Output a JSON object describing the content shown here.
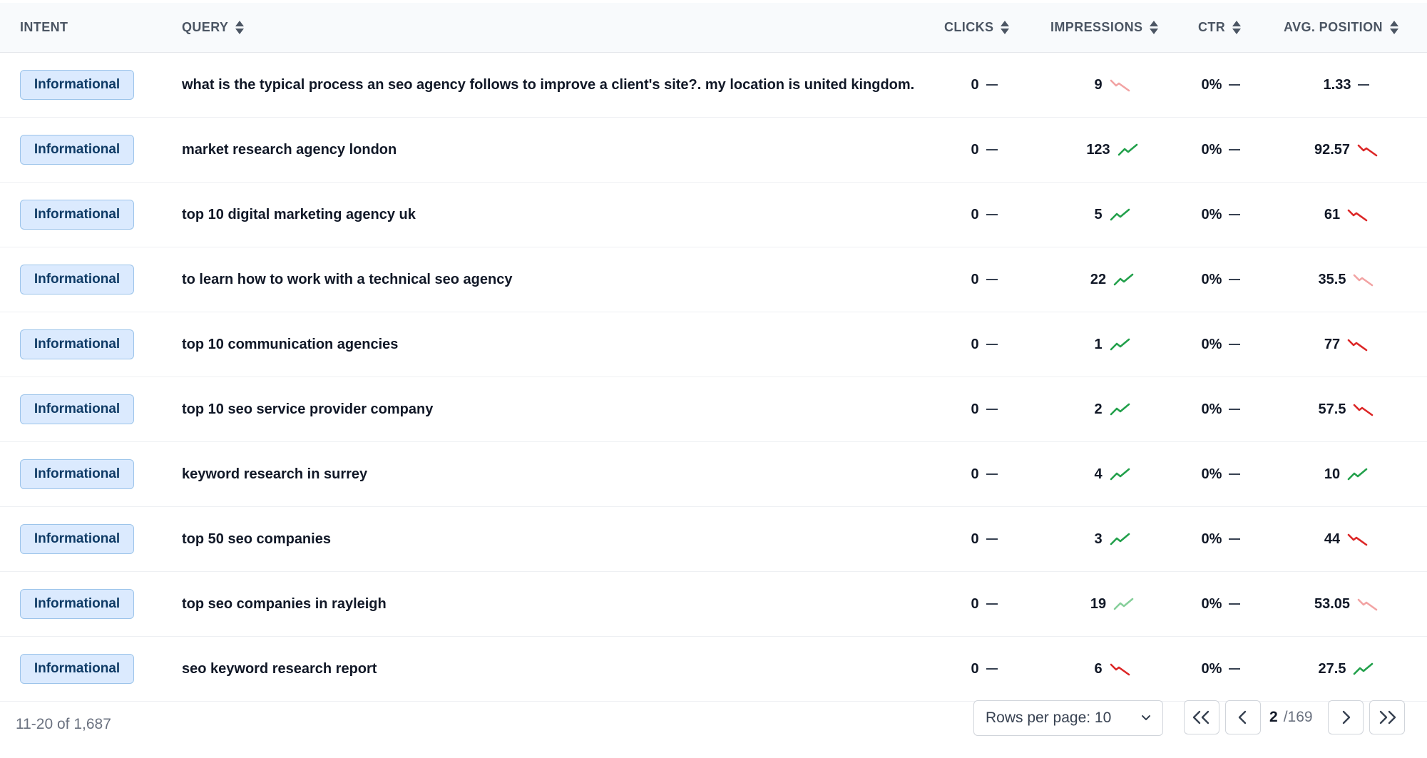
{
  "columns": {
    "intent": "INTENT",
    "query": "QUERY",
    "clicks": "CLICKS",
    "impressions": "IMPRESSIONS",
    "ctr": "CTR",
    "avg_position": "AVG. POSITION"
  },
  "colors": {
    "trend_up": "#22a04b",
    "trend_up_faint": "#86cf9a",
    "trend_down": "#dc2626",
    "trend_down_faint": "#f2a3a3",
    "badge_bg": "#dbeafe",
    "badge_border": "#9cc4ea"
  },
  "rows": [
    {
      "intent": "Informational",
      "query": "what is the typical process an seo agency follows to improve a client's site?. my location is united kingdom.",
      "clicks": "0",
      "impressions": "9",
      "impressions_trend": "down-faint-icon",
      "ctr": "0%",
      "avg_position": "1.33",
      "position_trend": "flat"
    },
    {
      "intent": "Informational",
      "query": "market research agency london",
      "clicks": "0",
      "impressions": "123",
      "impressions_trend": "up-icon",
      "ctr": "0%",
      "avg_position": "92.57",
      "position_trend": "down-icon"
    },
    {
      "intent": "Informational",
      "query": "top 10 digital marketing agency uk",
      "clicks": "0",
      "impressions": "5",
      "impressions_trend": "up-icon",
      "ctr": "0%",
      "avg_position": "61",
      "position_trend": "down-icon"
    },
    {
      "intent": "Informational",
      "query": "to learn how to work with a technical seo agency",
      "clicks": "0",
      "impressions": "22",
      "impressions_trend": "up-icon",
      "ctr": "0%",
      "avg_position": "35.5",
      "position_trend": "down-faint-icon"
    },
    {
      "intent": "Informational",
      "query": "top 10 communication agencies",
      "clicks": "0",
      "impressions": "1",
      "impressions_trend": "up-icon",
      "ctr": "0%",
      "avg_position": "77",
      "position_trend": "down-icon"
    },
    {
      "intent": "Informational",
      "query": "top 10 seo service provider company",
      "clicks": "0",
      "impressions": "2",
      "impressions_trend": "up-icon",
      "ctr": "0%",
      "avg_position": "57.5",
      "position_trend": "down-icon"
    },
    {
      "intent": "Informational",
      "query": "keyword research in surrey",
      "clicks": "0",
      "impressions": "4",
      "impressions_trend": "up-icon",
      "ctr": "0%",
      "avg_position": "10",
      "position_trend": "up-icon"
    },
    {
      "intent": "Informational",
      "query": "top 50 seo companies",
      "clicks": "0",
      "impressions": "3",
      "impressions_trend": "up-icon",
      "ctr": "0%",
      "avg_position": "44",
      "position_trend": "down-icon"
    },
    {
      "intent": "Informational",
      "query": "top seo companies in rayleigh",
      "clicks": "0",
      "impressions": "19",
      "impressions_trend": "up-faint-icon",
      "ctr": "0%",
      "avg_position": "53.05",
      "position_trend": "down-faint-icon"
    },
    {
      "intent": "Informational",
      "query": "seo keyword research report",
      "clicks": "0",
      "impressions": "6",
      "impressions_trend": "down-icon",
      "ctr": "0%",
      "avg_position": "27.5",
      "position_trend": "up-icon"
    }
  ],
  "footer": {
    "count": "11-20 of 1,687",
    "rows_per_page": "Rows per page: 10",
    "current_page": "2",
    "total_pages": "/169"
  }
}
